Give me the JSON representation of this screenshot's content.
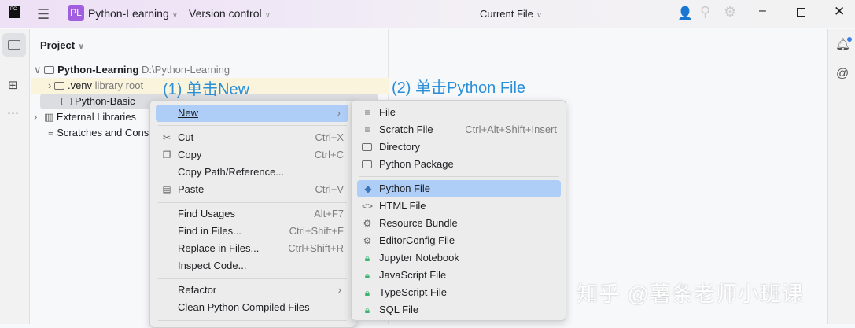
{
  "titlebar": {
    "logo": "PC",
    "project_badge": "PL",
    "project_name": "Python-Learning",
    "vcs": "Version control",
    "run_config": "Current File"
  },
  "project_panel": {
    "title": "Project",
    "tree": [
      {
        "label": "Python-Learning",
        "hint": "D:\\Python-Learning"
      },
      {
        "label": ".venv",
        "hint": "library root"
      },
      {
        "label": "Python-Basic",
        "hint": ""
      },
      {
        "label": "External Libraries",
        "hint": ""
      },
      {
        "label": "Scratches and Consoles",
        "hint": ""
      }
    ]
  },
  "context_menu": {
    "items": [
      {
        "label": "New",
        "shortcut": ""
      },
      {
        "label": "Cut",
        "shortcut": "Ctrl+X"
      },
      {
        "label": "Copy",
        "shortcut": "Ctrl+C"
      },
      {
        "label": "Copy Path/Reference...",
        "shortcut": ""
      },
      {
        "label": "Paste",
        "shortcut": "Ctrl+V"
      },
      {
        "label": "Find Usages",
        "shortcut": "Alt+F7"
      },
      {
        "label": "Find in Files...",
        "shortcut": "Ctrl+Shift+F"
      },
      {
        "label": "Replace in Files...",
        "shortcut": "Ctrl+Shift+R"
      },
      {
        "label": "Inspect Code...",
        "shortcut": ""
      },
      {
        "label": "Refactor",
        "shortcut": ""
      },
      {
        "label": "Clean Python Compiled Files",
        "shortcut": ""
      }
    ]
  },
  "new_submenu": {
    "items": [
      {
        "label": "File",
        "shortcut": ""
      },
      {
        "label": "Scratch File",
        "shortcut": "Ctrl+Alt+Shift+Insert"
      },
      {
        "label": "Directory",
        "shortcut": ""
      },
      {
        "label": "Python Package",
        "shortcut": ""
      },
      {
        "label": "Python File",
        "shortcut": ""
      },
      {
        "label": "HTML File",
        "shortcut": ""
      },
      {
        "label": "Resource Bundle",
        "shortcut": ""
      },
      {
        "label": "EditorConfig File",
        "shortcut": ""
      },
      {
        "label": "Jupyter Notebook",
        "shortcut": ""
      },
      {
        "label": "JavaScript File",
        "shortcut": ""
      },
      {
        "label": "TypeScript File",
        "shortcut": ""
      },
      {
        "label": "SQL File",
        "shortcut": ""
      }
    ]
  },
  "annotations": {
    "step1": "(1) 单击New",
    "step2": "(2) 单击Python File"
  },
  "watermark": "知乎 @薯条老师小班课",
  "colors": {
    "accent": "#2a8fd8",
    "highlight": "#aecdf7",
    "badge": "#a15ee0"
  }
}
